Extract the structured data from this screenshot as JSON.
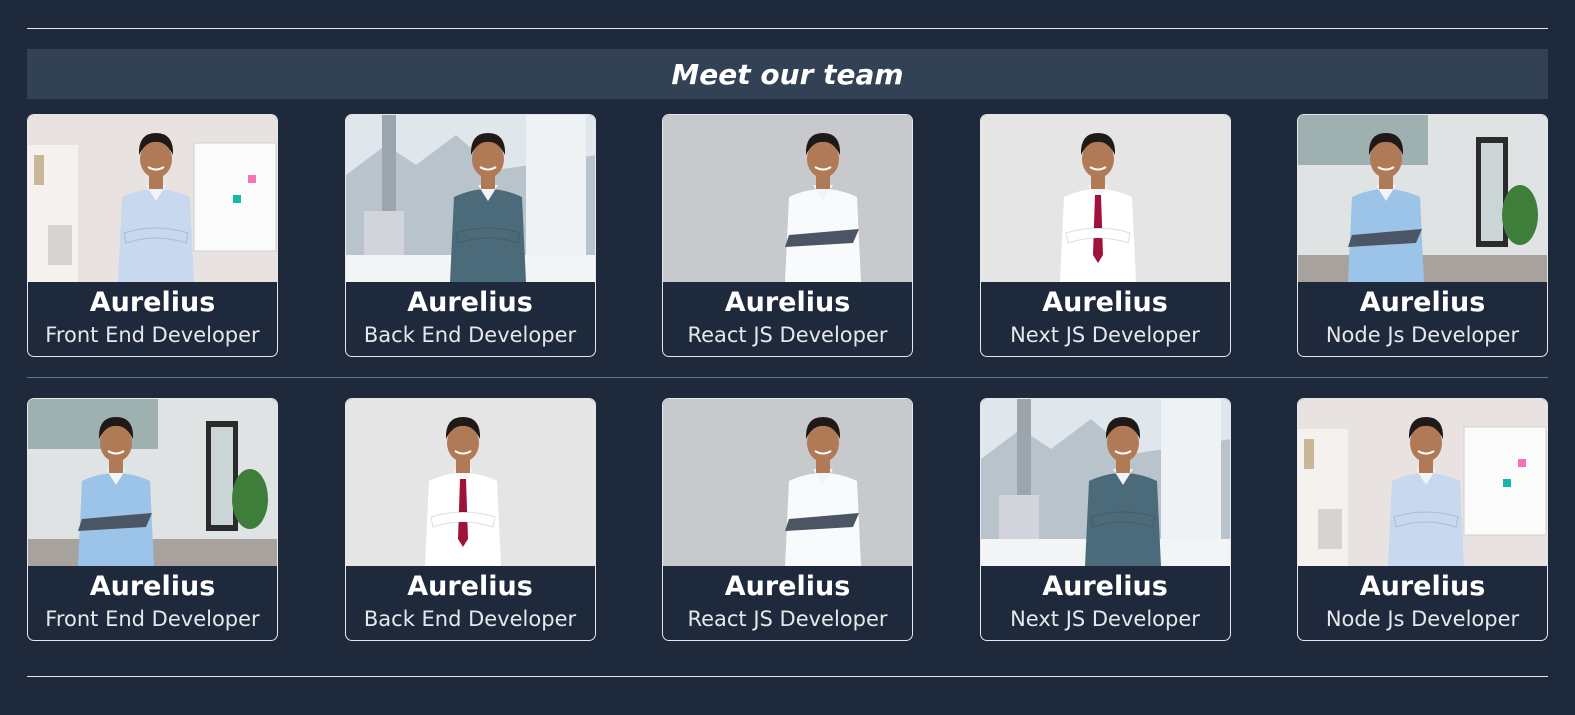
{
  "section_title": "Meet our team",
  "rows": [
    {
      "members": [
        {
          "name": "Aurelius",
          "role": "Front End Developer",
          "photo": "office-whiteboard"
        },
        {
          "name": "Aurelius",
          "role": "Back End Developer",
          "photo": "desk-window"
        },
        {
          "name": "Aurelius",
          "role": "React JS Developer",
          "photo": "laptop-grey"
        },
        {
          "name": "Aurelius",
          "role": "Next JS Developer",
          "photo": "tie-white"
        },
        {
          "name": "Aurelius",
          "role": "Node Js Developer",
          "photo": "office-laptop"
        }
      ]
    },
    {
      "members": [
        {
          "name": "Aurelius",
          "role": "Front End Developer",
          "photo": "office-laptop"
        },
        {
          "name": "Aurelius",
          "role": "Back End Developer",
          "photo": "tie-white"
        },
        {
          "name": "Aurelius",
          "role": "React JS Developer",
          "photo": "laptop-grey"
        },
        {
          "name": "Aurelius",
          "role": "Next JS Developer",
          "photo": "desk-window"
        },
        {
          "name": "Aurelius",
          "role": "Node Js Developer",
          "photo": "office-whiteboard"
        }
      ]
    }
  ],
  "colors": {
    "background": "#1e293b",
    "title_bar": "#334155",
    "card_border": "#e5e7eb"
  }
}
